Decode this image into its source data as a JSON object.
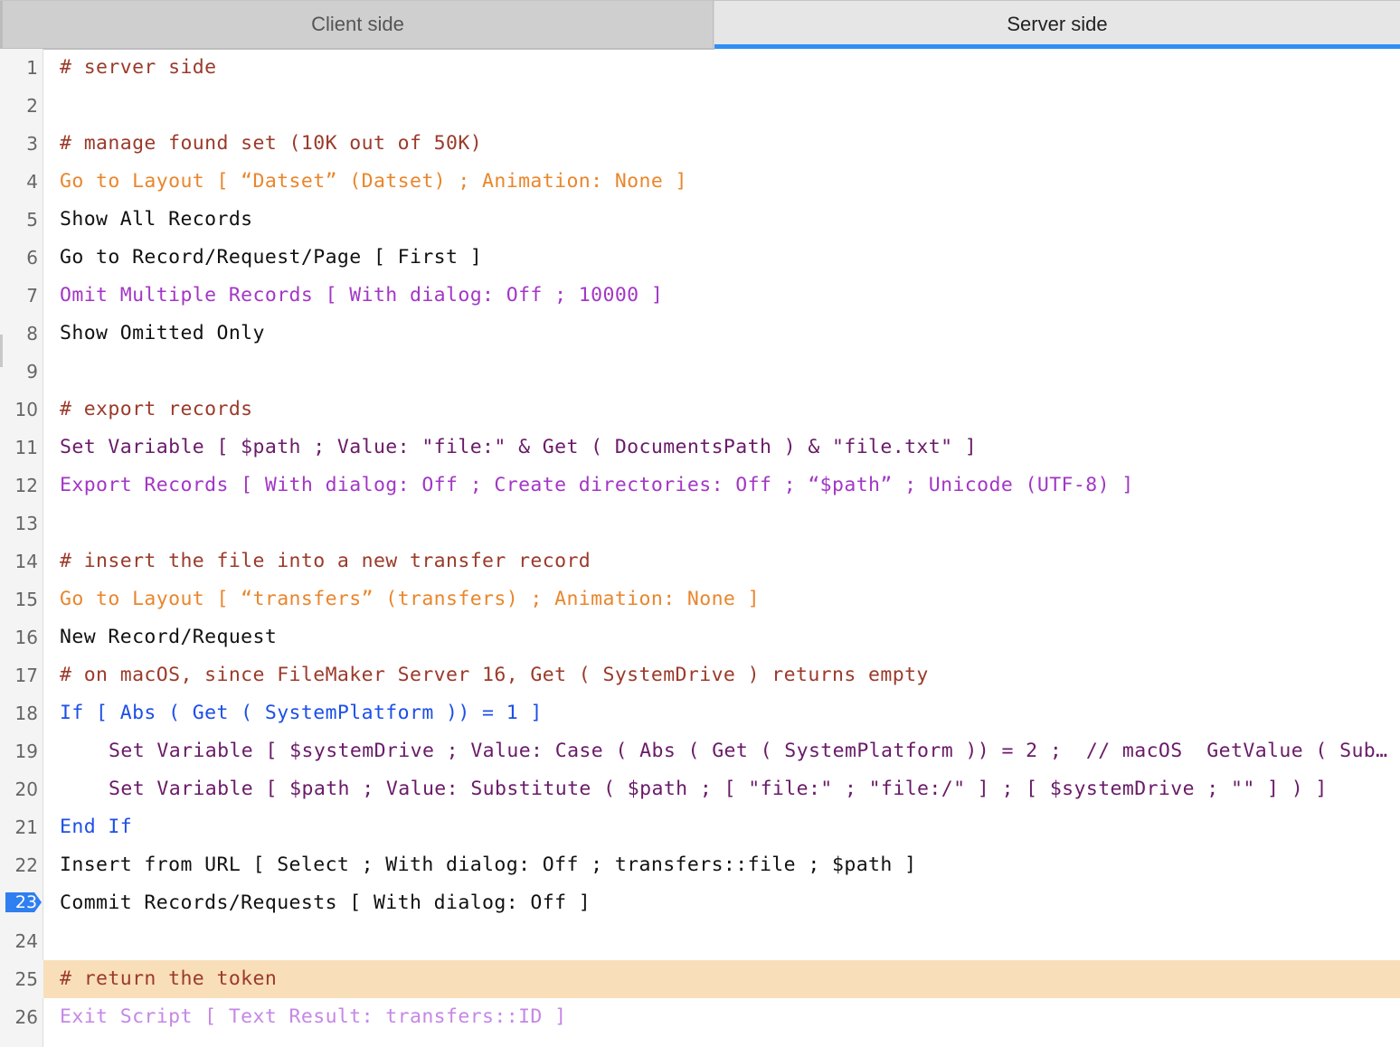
{
  "tabs": [
    {
      "label": "Client side",
      "active": false
    },
    {
      "label": "Server side",
      "active": true
    }
  ],
  "colors": {
    "accent": "#2f8ef3",
    "highlight_line": "#f8dfb9",
    "comment": "#9b3a2a",
    "layout_step": "#e9862c",
    "omit_export_step": "#a336c6",
    "variable_step": "#6a1a68",
    "control_step": "#1c4fe8",
    "exit_step": "#c587e6"
  },
  "script": {
    "current_line": 23,
    "highlighted_line": 25,
    "lines": [
      {
        "n": "1",
        "text": "# server side",
        "color": "comment",
        "indent": 0
      },
      {
        "n": "2",
        "text": "",
        "color": "black",
        "indent": 0
      },
      {
        "n": "3",
        "text": "# manage found set (10K out of 50K)",
        "color": "comment",
        "indent": 0
      },
      {
        "n": "4",
        "text": "Go to Layout [ “Datset” (Datset) ; Animation: None ]",
        "color": "orange",
        "indent": 0
      },
      {
        "n": "5",
        "text": "Show All Records",
        "color": "black",
        "indent": 0
      },
      {
        "n": "6",
        "text": "Go to Record/Request/Page [ First ]",
        "color": "black",
        "indent": 0
      },
      {
        "n": "7",
        "text": "Omit Multiple Records [ With dialog: Off ; 10000 ]",
        "color": "purple",
        "indent": 0
      },
      {
        "n": "8",
        "text": "Show Omitted Only",
        "color": "black",
        "indent": 0
      },
      {
        "n": "9",
        "text": "",
        "color": "black",
        "indent": 0
      },
      {
        "n": "10",
        "text": "# export records",
        "color": "comment",
        "indent": 0
      },
      {
        "n": "11",
        "text": "Set Variable [ $path ; Value: \"file:\" & Get ( DocumentsPath ) & \"file.txt\" ]",
        "color": "plum",
        "indent": 0
      },
      {
        "n": "12",
        "text": "Export Records [ With dialog: Off ; Create directories: Off ; “$path” ; Unicode (UTF-8) ]",
        "color": "purple",
        "indent": 0
      },
      {
        "n": "13",
        "text": "",
        "color": "black",
        "indent": 0
      },
      {
        "n": "14",
        "text": "# insert the file into a new transfer record",
        "color": "comment",
        "indent": 0
      },
      {
        "n": "15",
        "text": "Go to Layout [ “transfers” (transfers) ; Animation: None ]",
        "color": "orange",
        "indent": 0
      },
      {
        "n": "16",
        "text": "New Record/Request",
        "color": "black",
        "indent": 0
      },
      {
        "n": "17",
        "text": "# on macOS, since FileMaker Server 16, Get ( SystemDrive ) returns empty",
        "color": "comment",
        "indent": 0
      },
      {
        "n": "18",
        "text": "If [ Abs ( Get ( SystemPlatform )) = 1 ]",
        "color": "blue",
        "indent": 0
      },
      {
        "n": "19",
        "text": "Set Variable [ $systemDrive ; Value: Case ( Abs ( Get ( SystemPlatform )) = 2 ;  // macOS  GetValue ( Sub… ]",
        "color": "plum",
        "indent": 1
      },
      {
        "n": "20",
        "text": "Set Variable [ $path ; Value: Substitute ( $path ; [ \"file:\" ; \"file:/\" ] ; [ $systemDrive ; \"\" ] ) ]",
        "color": "plum",
        "indent": 1
      },
      {
        "n": "21",
        "text": "End If",
        "color": "blue",
        "indent": 0
      },
      {
        "n": "22",
        "text": "Insert from URL [ Select ; With dialog: Off ; transfers::file ; $path ]",
        "color": "black",
        "indent": 0
      },
      {
        "n": "23",
        "text": "Commit Records/Requests [ With dialog: Off ]",
        "color": "black",
        "indent": 0
      },
      {
        "n": "24",
        "text": "",
        "color": "black",
        "indent": 0
      },
      {
        "n": "25",
        "text": "# return the token",
        "color": "comment",
        "indent": 0
      },
      {
        "n": "26",
        "text": "Exit Script [ Text Result: transfers::ID ]",
        "color": "lilac",
        "indent": 0
      }
    ]
  }
}
